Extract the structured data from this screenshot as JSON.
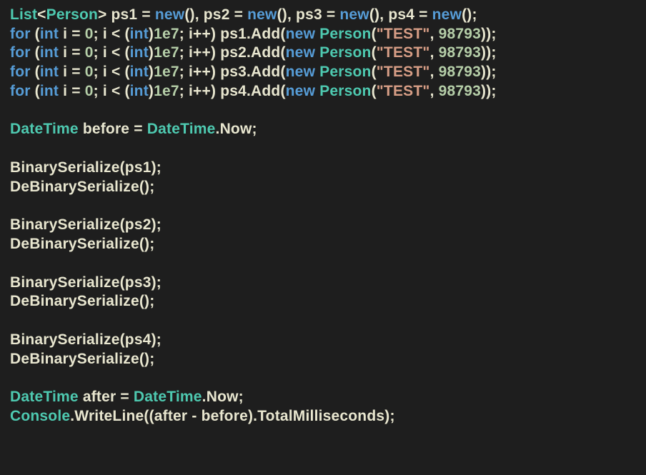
{
  "code": {
    "lines": [
      {
        "tokens": [
          [
            "c-type",
            "List"
          ],
          [
            "c-op",
            "<"
          ],
          [
            "c-type",
            "Person"
          ],
          [
            "c-op",
            "> "
          ],
          [
            "c-id",
            "ps1"
          ],
          [
            "c-op",
            " = "
          ],
          [
            "c-key",
            "new"
          ],
          [
            "c-op",
            "(), "
          ],
          [
            "c-id",
            "ps2"
          ],
          [
            "c-op",
            " = "
          ],
          [
            "c-key",
            "new"
          ],
          [
            "c-op",
            "(), "
          ],
          [
            "c-id",
            "ps3"
          ],
          [
            "c-op",
            " = "
          ],
          [
            "c-key",
            "new"
          ],
          [
            "c-op",
            "(), "
          ],
          [
            "c-id",
            "ps4"
          ],
          [
            "c-op",
            " = "
          ],
          [
            "c-key",
            "new"
          ],
          [
            "c-op",
            "();"
          ]
        ]
      },
      {
        "tokens": [
          [
            "c-key",
            "for"
          ],
          [
            "c-op",
            " ("
          ],
          [
            "c-key",
            "int"
          ],
          [
            "c-op",
            " "
          ],
          [
            "c-id",
            "i"
          ],
          [
            "c-op",
            " = "
          ],
          [
            "c-num",
            "0"
          ],
          [
            "c-op",
            "; "
          ],
          [
            "c-id",
            "i"
          ],
          [
            "c-op",
            " < ("
          ],
          [
            "c-key",
            "int"
          ],
          [
            "c-op",
            ")"
          ],
          [
            "c-num",
            "1e7"
          ],
          [
            "c-op",
            "; "
          ],
          [
            "c-id",
            "i"
          ],
          [
            "c-op",
            "++) "
          ],
          [
            "c-id",
            "ps1"
          ],
          [
            "c-op",
            "."
          ],
          [
            "c-method",
            "Add"
          ],
          [
            "c-op",
            "("
          ],
          [
            "c-key",
            "new"
          ],
          [
            "c-op",
            " "
          ],
          [
            "c-type",
            "Person"
          ],
          [
            "c-op",
            "("
          ],
          [
            "c-str",
            "\"TEST\""
          ],
          [
            "c-op",
            ", "
          ],
          [
            "c-num",
            "98793"
          ],
          [
            "c-op",
            "));"
          ]
        ]
      },
      {
        "tokens": [
          [
            "c-key",
            "for"
          ],
          [
            "c-op",
            " ("
          ],
          [
            "c-key",
            "int"
          ],
          [
            "c-op",
            " "
          ],
          [
            "c-id",
            "i"
          ],
          [
            "c-op",
            " = "
          ],
          [
            "c-num",
            "0"
          ],
          [
            "c-op",
            "; "
          ],
          [
            "c-id",
            "i"
          ],
          [
            "c-op",
            " < ("
          ],
          [
            "c-key",
            "int"
          ],
          [
            "c-op",
            ")"
          ],
          [
            "c-num",
            "1e7"
          ],
          [
            "c-op",
            "; "
          ],
          [
            "c-id",
            "i"
          ],
          [
            "c-op",
            "++) "
          ],
          [
            "c-id",
            "ps2"
          ],
          [
            "c-op",
            "."
          ],
          [
            "c-method",
            "Add"
          ],
          [
            "c-op",
            "("
          ],
          [
            "c-key",
            "new"
          ],
          [
            "c-op",
            " "
          ],
          [
            "c-type",
            "Person"
          ],
          [
            "c-op",
            "("
          ],
          [
            "c-str",
            "\"TEST\""
          ],
          [
            "c-op",
            ", "
          ],
          [
            "c-num",
            "98793"
          ],
          [
            "c-op",
            "));"
          ]
        ]
      },
      {
        "tokens": [
          [
            "c-key",
            "for"
          ],
          [
            "c-op",
            " ("
          ],
          [
            "c-key",
            "int"
          ],
          [
            "c-op",
            " "
          ],
          [
            "c-id",
            "i"
          ],
          [
            "c-op",
            " = "
          ],
          [
            "c-num",
            "0"
          ],
          [
            "c-op",
            "; "
          ],
          [
            "c-id",
            "i"
          ],
          [
            "c-op",
            " < ("
          ],
          [
            "c-key",
            "int"
          ],
          [
            "c-op",
            ")"
          ],
          [
            "c-num",
            "1e7"
          ],
          [
            "c-op",
            "; "
          ],
          [
            "c-id",
            "i"
          ],
          [
            "c-op",
            "++) "
          ],
          [
            "c-id",
            "ps3"
          ],
          [
            "c-op",
            "."
          ],
          [
            "c-method",
            "Add"
          ],
          [
            "c-op",
            "("
          ],
          [
            "c-key",
            "new"
          ],
          [
            "c-op",
            " "
          ],
          [
            "c-type",
            "Person"
          ],
          [
            "c-op",
            "("
          ],
          [
            "c-str",
            "\"TEST\""
          ],
          [
            "c-op",
            ", "
          ],
          [
            "c-num",
            "98793"
          ],
          [
            "c-op",
            "));"
          ]
        ]
      },
      {
        "tokens": [
          [
            "c-key",
            "for"
          ],
          [
            "c-op",
            " ("
          ],
          [
            "c-key",
            "int"
          ],
          [
            "c-op",
            " "
          ],
          [
            "c-id",
            "i"
          ],
          [
            "c-op",
            " = "
          ],
          [
            "c-num",
            "0"
          ],
          [
            "c-op",
            "; "
          ],
          [
            "c-id",
            "i"
          ],
          [
            "c-op",
            " < ("
          ],
          [
            "c-key",
            "int"
          ],
          [
            "c-op",
            ")"
          ],
          [
            "c-num",
            "1e7"
          ],
          [
            "c-op",
            "; "
          ],
          [
            "c-id",
            "i"
          ],
          [
            "c-op",
            "++) "
          ],
          [
            "c-id",
            "ps4"
          ],
          [
            "c-op",
            "."
          ],
          [
            "c-method",
            "Add"
          ],
          [
            "c-op",
            "("
          ],
          [
            "c-key",
            "new"
          ],
          [
            "c-op",
            " "
          ],
          [
            "c-type",
            "Person"
          ],
          [
            "c-op",
            "("
          ],
          [
            "c-str",
            "\"TEST\""
          ],
          [
            "c-op",
            ", "
          ],
          [
            "c-num",
            "98793"
          ],
          [
            "c-op",
            "));"
          ]
        ]
      },
      {
        "blank": true
      },
      {
        "tokens": [
          [
            "c-type",
            "DateTime"
          ],
          [
            "c-op",
            " "
          ],
          [
            "c-id",
            "before"
          ],
          [
            "c-op",
            " = "
          ],
          [
            "c-type",
            "DateTime"
          ],
          [
            "c-op",
            "."
          ],
          [
            "c-id",
            "Now"
          ],
          [
            "c-op",
            ";"
          ]
        ]
      },
      {
        "blank": true
      },
      {
        "tokens": [
          [
            "c-method",
            "BinarySerialize"
          ],
          [
            "c-op",
            "("
          ],
          [
            "c-id",
            "ps1"
          ],
          [
            "c-op",
            ");"
          ]
        ]
      },
      {
        "tokens": [
          [
            "c-method",
            "DeBinarySerialize"
          ],
          [
            "c-op",
            "();"
          ]
        ]
      },
      {
        "blank": true
      },
      {
        "tokens": [
          [
            "c-method",
            "BinarySerialize"
          ],
          [
            "c-op",
            "("
          ],
          [
            "c-id",
            "ps2"
          ],
          [
            "c-op",
            ");"
          ]
        ]
      },
      {
        "tokens": [
          [
            "c-method",
            "DeBinarySerialize"
          ],
          [
            "c-op",
            "();"
          ]
        ]
      },
      {
        "blank": true
      },
      {
        "tokens": [
          [
            "c-method",
            "BinarySerialize"
          ],
          [
            "c-op",
            "("
          ],
          [
            "c-id",
            "ps3"
          ],
          [
            "c-op",
            ");"
          ]
        ]
      },
      {
        "tokens": [
          [
            "c-method",
            "DeBinarySerialize"
          ],
          [
            "c-op",
            "();"
          ]
        ]
      },
      {
        "blank": true
      },
      {
        "tokens": [
          [
            "c-method",
            "BinarySerialize"
          ],
          [
            "c-op",
            "("
          ],
          [
            "c-id",
            "ps4"
          ],
          [
            "c-op",
            ");"
          ]
        ]
      },
      {
        "tokens": [
          [
            "c-method",
            "DeBinarySerialize"
          ],
          [
            "c-op",
            "();"
          ]
        ]
      },
      {
        "blank": true
      },
      {
        "tokens": [
          [
            "c-type",
            "DateTime"
          ],
          [
            "c-op",
            " "
          ],
          [
            "c-id",
            "after"
          ],
          [
            "c-op",
            " = "
          ],
          [
            "c-type",
            "DateTime"
          ],
          [
            "c-op",
            "."
          ],
          [
            "c-id",
            "Now"
          ],
          [
            "c-op",
            ";"
          ]
        ]
      },
      {
        "tokens": [
          [
            "c-type",
            "Console"
          ],
          [
            "c-op",
            "."
          ],
          [
            "c-method",
            "WriteLine"
          ],
          [
            "c-op",
            "(("
          ],
          [
            "c-id",
            "after"
          ],
          [
            "c-op",
            " - "
          ],
          [
            "c-id",
            "before"
          ],
          [
            "c-op",
            ")."
          ],
          [
            "c-id",
            "TotalMilliseconds"
          ],
          [
            "c-op",
            ");"
          ]
        ]
      }
    ]
  }
}
